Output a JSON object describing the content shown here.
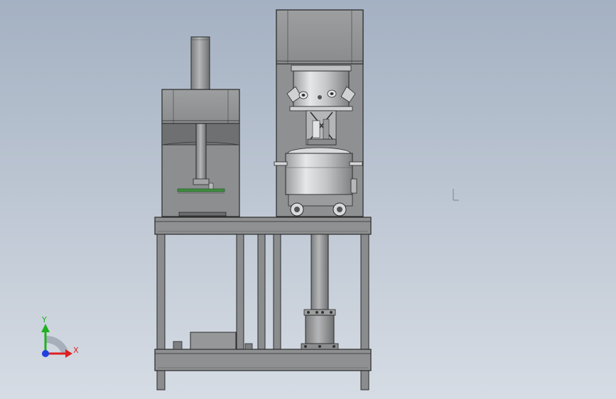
{
  "viewport": {
    "background_top": "#a4b1c2",
    "background_bottom": "#d6dce4"
  },
  "machine": {
    "frame_color": "#8a8c8e",
    "frame_edge_color": "#2a2a2a",
    "vessel_color": "#c8cacc",
    "highlight_color": "#e8e8e8",
    "accent_color": "#3e8e3e"
  },
  "triad": {
    "x_label": "X",
    "y_label": "Y",
    "x_color": "#e02020",
    "y_color": "#20b020",
    "z_color": "#2040e0"
  }
}
